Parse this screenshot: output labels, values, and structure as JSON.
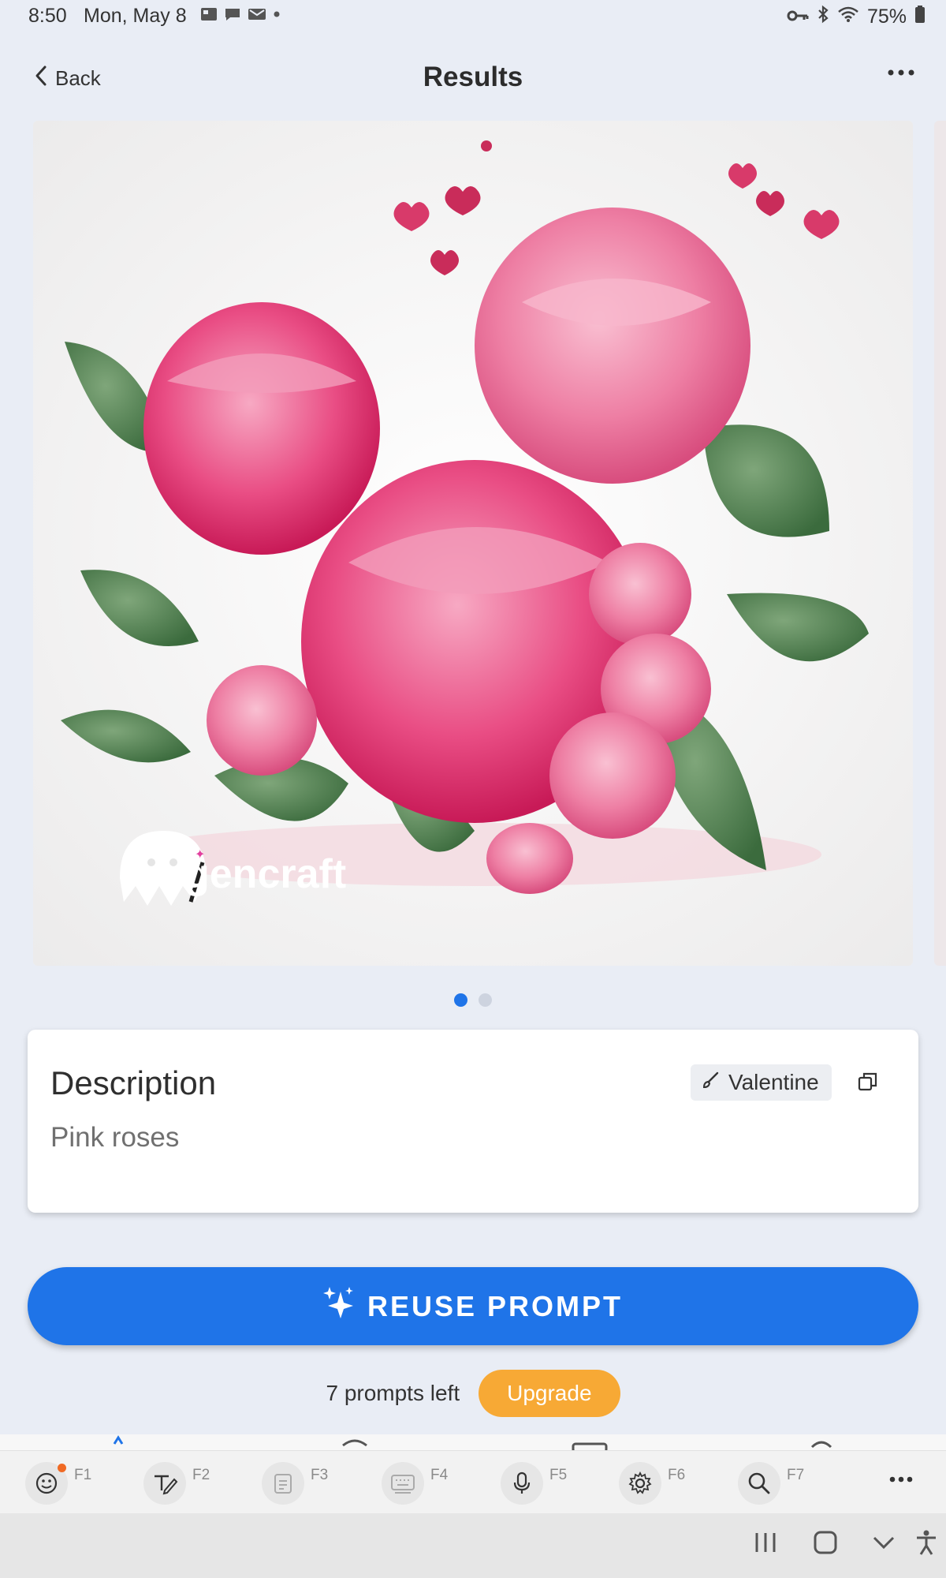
{
  "status_bar": {
    "time": "8:50",
    "date": "Mon, May 8",
    "battery": "75%"
  },
  "header": {
    "back_label": "Back",
    "title": "Results"
  },
  "image": {
    "watermark": "gencraft",
    "dots_count": 2,
    "active_index": 0
  },
  "description": {
    "heading": "Description",
    "text": "Pink roses",
    "style_tag": "Valentine"
  },
  "actions": {
    "reuse_label": "REUSE PROMPT",
    "prompts_left": "7 prompts left",
    "upgrade_label": "Upgrade"
  },
  "keyboard_toolbar": {
    "keys": [
      {
        "label": "F1",
        "icon": "emoji-icon"
      },
      {
        "label": "F2",
        "icon": "handwriting-icon"
      },
      {
        "label": "F3",
        "icon": "clipboard-icon"
      },
      {
        "label": "F4",
        "icon": "keyboard-icon"
      },
      {
        "label": "F5",
        "icon": "microphone-icon"
      },
      {
        "label": "F6",
        "icon": "settings-icon"
      },
      {
        "label": "F7",
        "icon": "search-icon"
      }
    ]
  },
  "colors": {
    "accent": "#1f74e8",
    "upgrade": "#f7a935",
    "background": "#e9edf5"
  }
}
